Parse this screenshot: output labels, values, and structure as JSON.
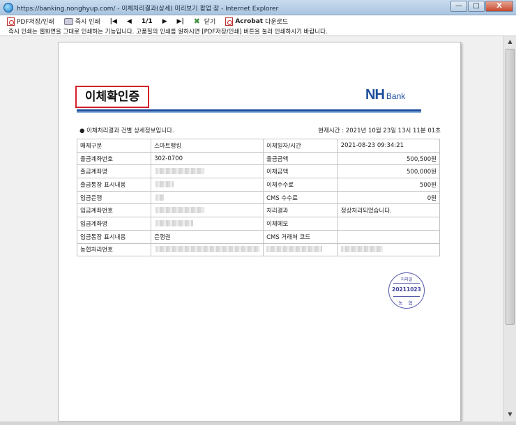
{
  "window": {
    "title": "https://banking.nonghyup.com/ - 이체처리결과(상세) 미리보기 팝업 창 - Internet Explorer",
    "min_label": "—",
    "max_label": "□",
    "close_label": "X"
  },
  "toolbar": {
    "pdf_save_print": "PDF저장/인쇄",
    "instant_print": "즉시 인쇄",
    "first": "|◀",
    "prev": "◀",
    "page_indicator": "1/1",
    "next": "▶",
    "last": "▶|",
    "close": "닫기",
    "acrobat_prefix": "Acrobat",
    "acrobat_suffix": "다운로드"
  },
  "notice": "즉시 인쇄는 웹화면을 그대로 인쇄하는 기능입니다. 고품질의 인쇄를 원하시면 [PDF저장/인쇄] 버튼을 눌러 인쇄하시기 바랍니다.",
  "document": {
    "title": "이체확인증",
    "logo_nh": "NH",
    "logo_bank": "Bank",
    "info_left": "● 이체처리결과 건별 상세정보입니다.",
    "info_right": "현재시간 : 2021년 10월 23일 13시 11분 01초",
    "rows": [
      {
        "l1": "매체구분",
        "v1": "스마트뱅킹",
        "l2": "이체일자/시간",
        "v2": "2021-08-23 09:34:21"
      },
      {
        "l1": "출금계좌번호",
        "v1": "302-0700",
        "l2": "출금금액",
        "v2": "500,500원"
      },
      {
        "l1": "출금계좌명",
        "v1": "",
        "l2": "이체금액",
        "v2": "500,000원"
      },
      {
        "l1": "출금통장 표시내용",
        "v1": "",
        "l2": "이체수수료",
        "v2": "500원"
      },
      {
        "l1": "입금은행",
        "v1": "",
        "l2": "CMS 수수료",
        "v2": "0원"
      },
      {
        "l1": "입금계좌번호",
        "v1": "",
        "l2": "처리결과",
        "v2": "정상처리되었습니다."
      },
      {
        "l1": "입금계좌명",
        "v1": "",
        "l2": "이체메모",
        "v2": ""
      },
      {
        "l1": "입금통장 표시내용",
        "v1": "은행권",
        "l2": "CMS 거래처 코드",
        "v2": ""
      },
      {
        "l1": "농협처리번호",
        "v1": "",
        "l2": "",
        "v2": ""
      }
    ],
    "stamp": {
      "top": "처리일",
      "date": "20211023",
      "bottom": "농 협"
    }
  }
}
